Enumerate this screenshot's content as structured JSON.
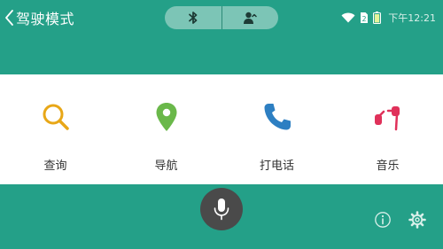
{
  "header": {
    "title": "驾驶模式"
  },
  "mode_switch": {
    "left_icon": "bluetooth-icon",
    "right_icon": "contact-icon"
  },
  "status_bar": {
    "icons": [
      "wifi-icon",
      "sim-icon",
      "battery-icon"
    ],
    "time": "下午12:21"
  },
  "shortcuts": [
    {
      "label": "查询",
      "icon": "search-icon",
      "color": "#e8a717"
    },
    {
      "label": "导航",
      "icon": "location-pin-icon",
      "color": "#6ab84a"
    },
    {
      "label": "打电话",
      "icon": "phone-icon",
      "color": "#2d7fc2"
    },
    {
      "label": "音乐",
      "icon": "music-icon",
      "color": "#e0315a"
    }
  ],
  "footer": {
    "mic_icon": "microphone-icon",
    "info_icon": "info-icon",
    "settings_icon": "gear-icon"
  },
  "colors": {
    "accent": "#24a088",
    "panel": "#ffffff",
    "mic_button": "#4a4a4a"
  }
}
